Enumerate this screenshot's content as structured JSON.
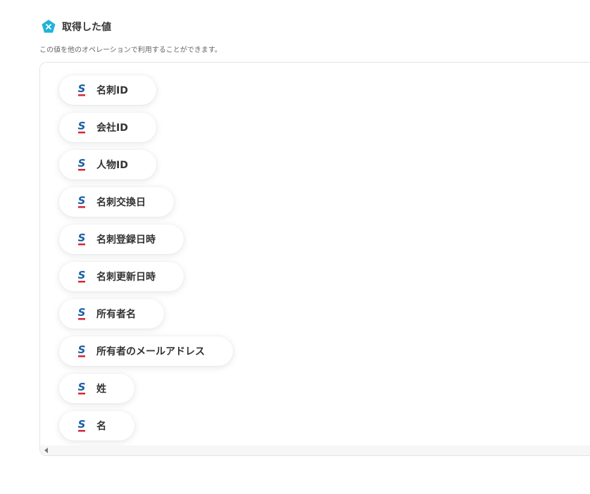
{
  "header": {
    "title": "取得した値",
    "icon": "x-variable-icon",
    "icon_color": "#1fb3d9"
  },
  "subtitle": "この値を他のオペレーションで利用することができます。",
  "service_icon": "sansan-icon",
  "service_colors": {
    "primary": "#1a5ea8",
    "accent": "#d7262e"
  },
  "values": [
    {
      "label": "名刺ID"
    },
    {
      "label": "会社ID"
    },
    {
      "label": "人物ID"
    },
    {
      "label": "名刺交換日"
    },
    {
      "label": "名刺登録日時"
    },
    {
      "label": "名刺更新日時"
    },
    {
      "label": "所有者名"
    },
    {
      "label": "所有者のメールアドレス"
    },
    {
      "label": "姓"
    },
    {
      "label": "名"
    }
  ]
}
